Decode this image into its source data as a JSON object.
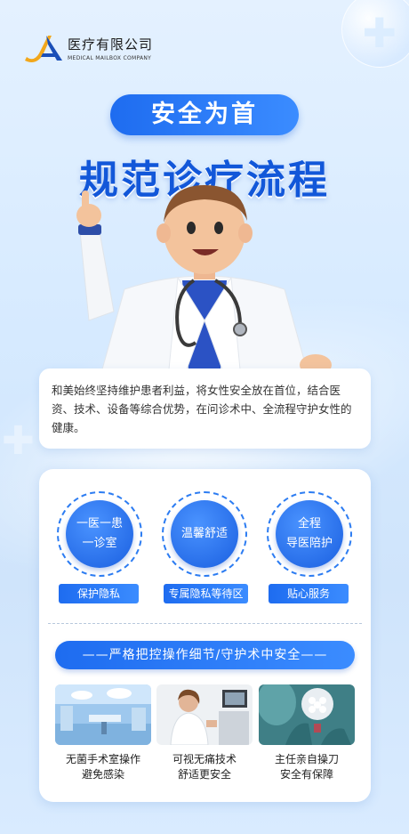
{
  "logo": {
    "company_cn": "医疗有限公司",
    "company_en": "MEDICAL MAILBOX COMPANY"
  },
  "headline": {
    "pill": "安全为首",
    "main": "规范诊疗流程"
  },
  "intro": {
    "text": "和美始终坚持维护患者利益，将女性安全放在首位，结合医资、技术、设备等综合优势，在问诊术中、全流程守护女性的健康。"
  },
  "features": [
    {
      "line1": "一医一患",
      "line2": "一诊室",
      "tag": "保护隐私"
    },
    {
      "line1": "温馨舒适",
      "line2": "",
      "tag": "专属隐私等待区"
    },
    {
      "line1": "全程",
      "line2": "导医陪护",
      "tag": "贴心服务"
    }
  ],
  "section": {
    "title": "——严格把控操作细节/守护术中安全——"
  },
  "photos": [
    {
      "line1": "无菌手术室操作",
      "line2": "避免感染",
      "icon": "operating-room-photo"
    },
    {
      "line1": "可视无痛技术",
      "line2": "舒适更安全",
      "icon": "doctor-ultrasound-photo"
    },
    {
      "line1": "主任亲自操刀",
      "line2": "安全有保障",
      "icon": "surgery-photo"
    }
  ],
  "colors": {
    "primary": "#1e6cf0",
    "title": "#1257d9",
    "background": "#d6eaff"
  }
}
